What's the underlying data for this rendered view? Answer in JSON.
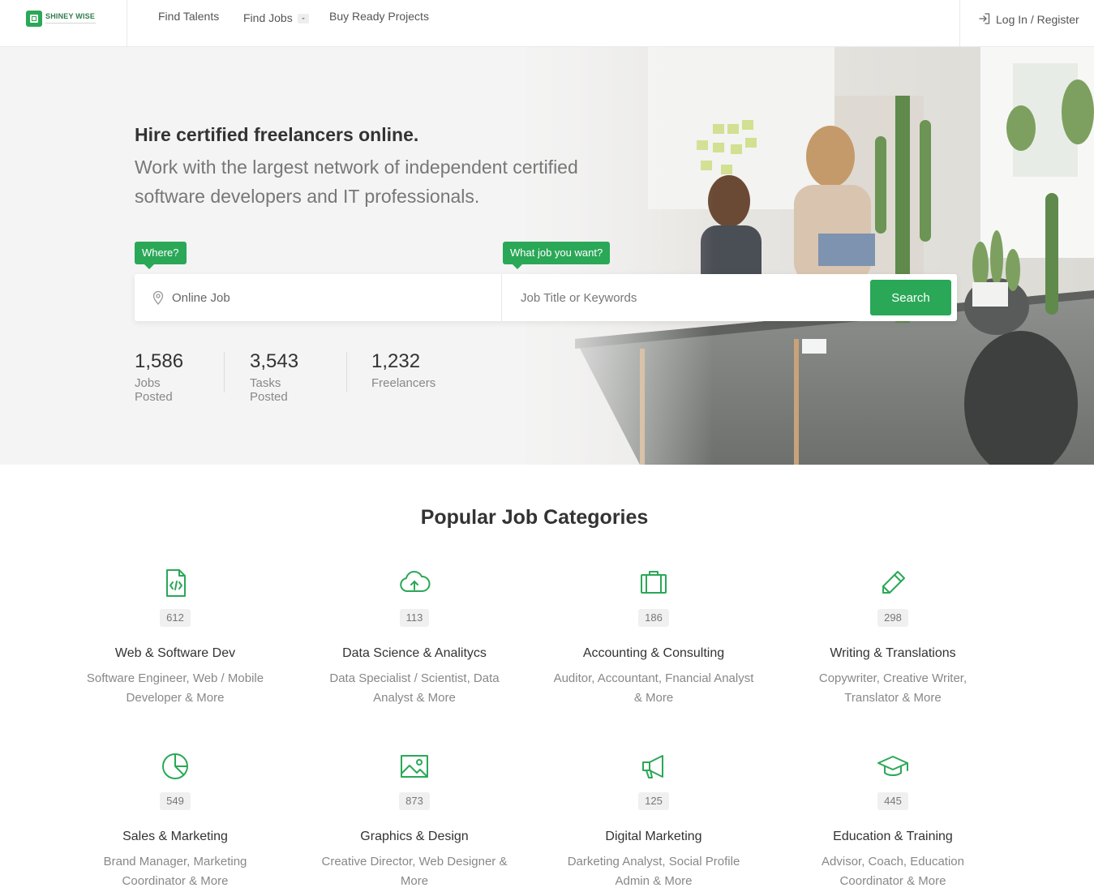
{
  "header": {
    "logo_text": "SHINEY WISE",
    "nav": [
      {
        "label": "Find Talents"
      },
      {
        "label": "Find Jobs"
      },
      {
        "label": "Buy Ready Projects"
      }
    ],
    "login_label": "Log In / Register"
  },
  "hero": {
    "title": "Hire certified freelancers online.",
    "subtitle": "Work with the largest network of independent certified software developers and IT professionals.",
    "where_tag": "Where?",
    "what_tag": "What job you want?",
    "where_value": "Online Job",
    "what_placeholder": "Job Title or Keywords",
    "search_label": "Search",
    "stats": [
      {
        "value": "1,586",
        "label": "Jobs Posted"
      },
      {
        "value": "3,543",
        "label": "Tasks Posted"
      },
      {
        "value": "1,232",
        "label": "Freelancers"
      }
    ]
  },
  "categories": {
    "title": "Popular Job Categories",
    "items": [
      {
        "icon": "code-file-icon",
        "count": "612",
        "title": "Web & Software Dev",
        "desc": "Software Engineer, Web / Mobile Developer & More"
      },
      {
        "icon": "cloud-upload-icon",
        "count": "113",
        "title": "Data Science & Analitycs",
        "desc": "Data Specialist / Scientist, Data Analyst & More"
      },
      {
        "icon": "briefcase-icon",
        "count": "186",
        "title": "Accounting & Consulting",
        "desc": "Auditor, Accountant, Fnancial Analyst & More"
      },
      {
        "icon": "pencil-icon",
        "count": "298",
        "title": "Writing & Translations",
        "desc": "Copywriter, Creative Writer, Translator & More"
      },
      {
        "icon": "pie-chart-icon",
        "count": "549",
        "title": "Sales & Marketing",
        "desc": "Brand Manager, Marketing Coordinator & More"
      },
      {
        "icon": "image-icon",
        "count": "873",
        "title": "Graphics & Design",
        "desc": "Creative Director, Web Designer & More"
      },
      {
        "icon": "megaphone-icon",
        "count": "125",
        "title": "Digital Marketing",
        "desc": "Darketing Analyst, Social Profile Admin & More"
      },
      {
        "icon": "graduation-cap-icon",
        "count": "445",
        "title": "Education & Training",
        "desc": "Advisor, Coach, Education Coordinator & More"
      }
    ]
  },
  "colors": {
    "accent": "#2aa857",
    "hero_bg": "#f4f4f4"
  }
}
